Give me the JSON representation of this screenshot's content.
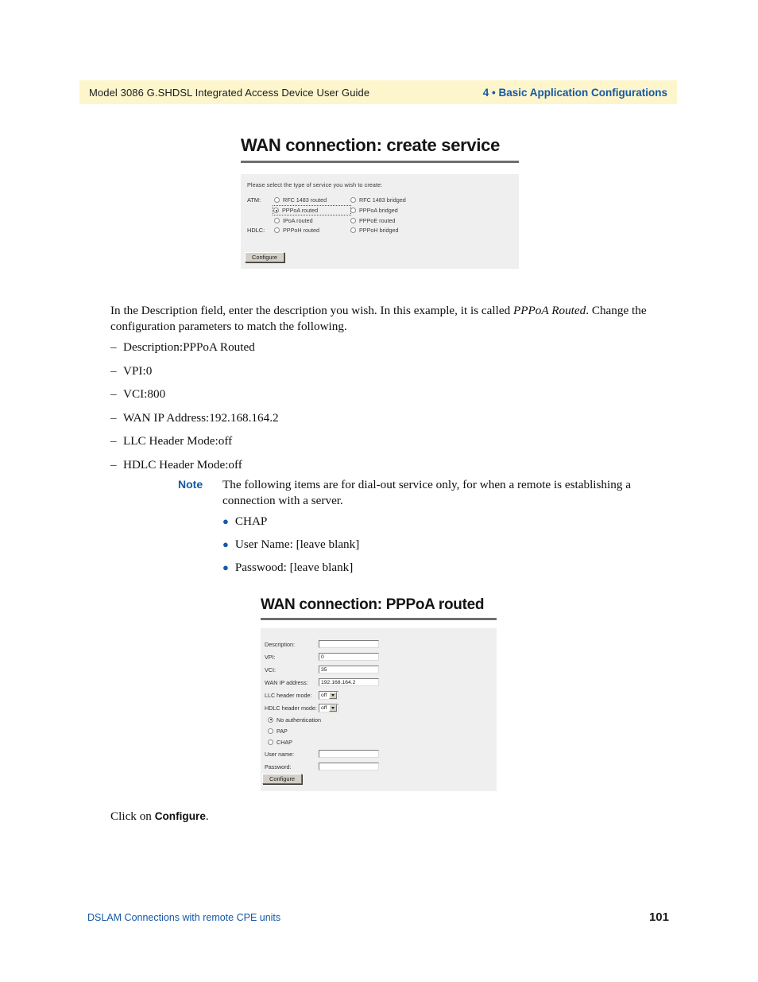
{
  "header": {
    "left_title": "Model 3086 G.SHDSL Integrated Access Device User Guide",
    "right_title": "4 • Basic Application Configurations",
    "band_color": "#fdf6cd",
    "accent_color": "#1558a6"
  },
  "figure_create_service": {
    "title": "WAN connection: create service",
    "intro": "Please select the type of service you wish to create:",
    "groups": [
      {
        "protocol": "ATM:",
        "options": [
          {
            "label": "RFC 1483 routed",
            "checked": false,
            "focused": false
          },
          {
            "label": "RFC 1483 bridged",
            "checked": false,
            "focused": false
          }
        ]
      },
      {
        "protocol": "",
        "options": [
          {
            "label": "PPPoA routed",
            "checked": true,
            "focused": true
          },
          {
            "label": "PPPoA bridged",
            "checked": false,
            "focused": false
          }
        ]
      },
      {
        "protocol": "",
        "options": [
          {
            "label": "IPoA routed",
            "checked": false,
            "focused": false
          },
          {
            "label": "PPPoE routed",
            "checked": false,
            "focused": false
          }
        ]
      },
      {
        "protocol": "HDLC:",
        "options": [
          {
            "label": "PPPoH routed",
            "checked": false,
            "focused": false
          },
          {
            "label": "PPPoH bridged",
            "checked": false,
            "focused": false
          }
        ]
      }
    ],
    "button_label": "Configure"
  },
  "paragraph_intro": {
    "before_italic": "In the Description field, enter the description you wish.  In this example, it is called ",
    "italic": "PPPoA  Routed",
    "after_italic": ".  Change the configuration parameters to match the following."
  },
  "dash_list": [
    "Description:PPPoA Routed",
    "VPI:0",
    "VCI:800",
    "WAN IP Address:192.168.164.2",
    "LLC Header Mode:off",
    "HDLC Header Mode:off"
  ],
  "note": {
    "label": "Note",
    "text": "The following items are for dial-out service only, for when a remote is establishing a connection with a server.",
    "bullets": [
      "CHAP",
      "User Name: [leave blank]",
      "Passwood: [leave blank]"
    ]
  },
  "figure_pppoa_routed": {
    "title": "WAN connection: PPPoA routed",
    "fields": [
      {
        "label": "Description:",
        "value": "",
        "type": "text"
      },
      {
        "label": "VPI:",
        "value": "0",
        "type": "text"
      },
      {
        "label": "VCI:",
        "value": "35",
        "type": "text"
      },
      {
        "label": "WAN IP address:",
        "value": "192.168.164.2",
        "type": "text"
      },
      {
        "label": "LLC header mode:",
        "value": "off",
        "type": "select"
      },
      {
        "label": "HDLC header mode:",
        "value": "off",
        "type": "select"
      }
    ],
    "auth_options": [
      {
        "label": "No authentication",
        "checked": true
      },
      {
        "label": "PAP",
        "checked": false
      },
      {
        "label": "CHAP",
        "checked": false
      }
    ],
    "credential_fields": [
      {
        "label": "User name:",
        "value": ""
      },
      {
        "label": "Password:",
        "value": ""
      }
    ],
    "button_label": "Configure"
  },
  "paragraph_click": {
    "before": "Click on ",
    "bold": "Configure",
    "after": "."
  },
  "footer": {
    "left": "DSLAM Connections with remote CPE units",
    "page_number": "101"
  }
}
